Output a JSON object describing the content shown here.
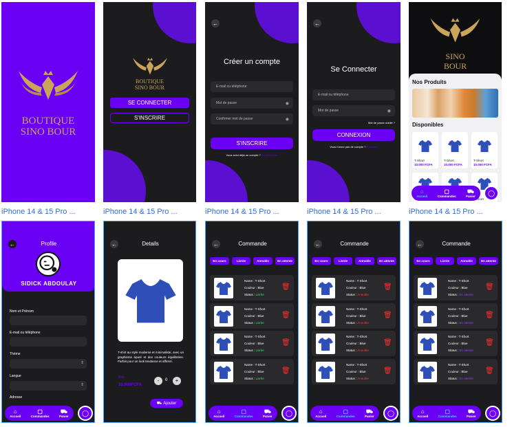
{
  "captions": [
    "iPhone 14 & 15 Pro ...",
    "iPhone 14 & 15 Pro ...",
    "iPhone 14 & 15 Pro ...",
    "iPhone 14 & 15 Pro ...",
    "iPhone 14 & 15 Pro ..."
  ],
  "brand": {
    "line1": "BOUTIQUE",
    "line2": "SINO BOUR"
  },
  "brand_small": {
    "line1": "BOUTIQUE",
    "line2": "SINO BOUR"
  },
  "brand_dark": {
    "line1": "SINO",
    "line2": "BOUR"
  },
  "welcome": {
    "login_button": "SE CONNECTER",
    "signup_button": "S'INSCRIRE"
  },
  "signup": {
    "title": "Créer un compte",
    "email_placeholder": "E-mail ou téléphone",
    "password_placeholder": "Mot de passe",
    "confirm_placeholder": "Confirmer mot de passe",
    "submit": "S'INSCRIRE",
    "footer": "Vous avez déjà un compte ?",
    "footer_link": "Se connecter"
  },
  "login": {
    "title": "Se Connecter",
    "email_placeholder": "E-mail ou téléphone",
    "password_placeholder": "Mot de passe",
    "forgot": "Mot de passe oublié ?",
    "submit": "CONNEXION",
    "footer": "Vous n'avez pas de compte ?",
    "footer_link": "S'inscrire"
  },
  "home": {
    "section_products": "Nos Produits",
    "section_available": "Disponibles",
    "products": [
      {
        "name": "T-Short",
        "price": "10.000 FCFA"
      },
      {
        "name": "T-Short",
        "price": "10.000 FCFA"
      },
      {
        "name": "T-Short",
        "price": "10.000 FCFA"
      },
      {
        "name": "T-Short",
        "price": ""
      },
      {
        "name": "T-Short",
        "price": ""
      },
      {
        "name": "T-Short",
        "price": ""
      }
    ]
  },
  "nav": {
    "home": "Accueil",
    "orders": "Commandes",
    "cart": "Panier"
  },
  "profile": {
    "title": "Profile",
    "username": "SIDICK ABDOULAY",
    "labels": [
      "Nom et Prénom",
      "E-mail ou téléphone",
      "Thème",
      "Langue",
      "Adresse"
    ]
  },
  "details": {
    "title": "Details",
    "description": "T-shirt au style moderne et minimaliste, avec un graphisme épuré et des couleurs équilibrées. Parfait pour un look tendance et affirmé.",
    "price_label": "Prix",
    "price": "10.000FCFA",
    "minus": "-",
    "qty": "0",
    "plus": "+",
    "add": "Ajouter"
  },
  "orders": {
    "title": "Commande",
    "tabs": [
      "En cours",
      "Livrée",
      "Annulée",
      "En attente"
    ],
    "name_label": "Name : T-Short",
    "color_label": "Couleur : Blue",
    "status_label": "Status :",
    "status_delivered": "Livrée",
    "status_cancelled": "Annulée",
    "status_pending": "En attente"
  },
  "colors": {
    "accent": "#6a00f4",
    "delivered": "#3ee06b",
    "cancelled": "#ff3b3b",
    "pending": "#8b3dff"
  }
}
